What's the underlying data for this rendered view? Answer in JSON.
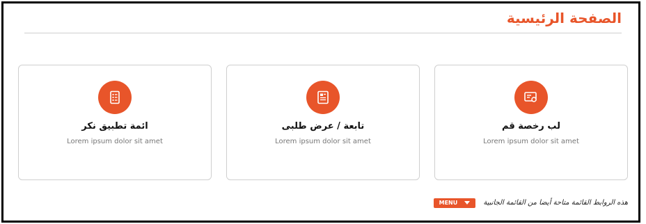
{
  "header": {
    "title": "الصفحة الرئيسية"
  },
  "cards": [
    {
      "title": "لب رخصة قم",
      "description": "Lorem ipsum dolor sit amet",
      "icon": "license-card-icon"
    },
    {
      "title": "تابعة / عرض طلبى",
      "description": "Lorem ipsum dolor sit amet",
      "icon": "document-icon"
    },
    {
      "title": "ائمة تطبيق نكر",
      "description": "Lorem ipsum dolor sit amet",
      "icon": "checklist-icon"
    }
  ],
  "footer": {
    "note": "هذه الروابط القائمة متاحة أيضا من القائمة الجانبية",
    "menu_label": "MENU"
  },
  "colors": {
    "accent": "#e8552a",
    "border": "#cfcfcf"
  }
}
